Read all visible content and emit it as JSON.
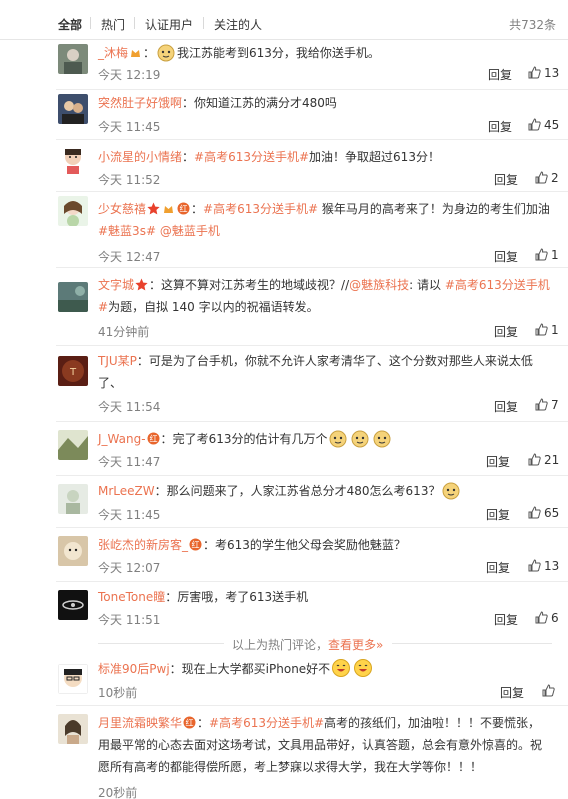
{
  "tabs": [
    {
      "label": "全部",
      "active": true
    },
    {
      "label": "热门",
      "active": false
    },
    {
      "label": "认证用户",
      "active": false
    },
    {
      "label": "关注的人",
      "active": false
    }
  ],
  "total_label": "共732条",
  "reply_label": "回复",
  "comments": [
    {
      "user": "_沐梅",
      "sep": "：",
      "text_a": "我江苏能考到613分，我给你送手机。",
      "time": "今天 12:19",
      "likes": "13"
    },
    {
      "user": "突然肚子好饿啊",
      "sep": "：",
      "text_a": "你知道江苏的满分才480吗",
      "time": "今天 11:45",
      "likes": "45"
    },
    {
      "user": "小流星的小情绪",
      "sep": "：",
      "topic": "#高考613分送手机#",
      "text_a": "加油！争取超过613分！",
      "time": "今天 11:52",
      "likes": "2"
    },
    {
      "user": "少女慈禧",
      "sep": "：",
      "topic": "#高考613分送手机#",
      "text_a": " 猴年马月的高考来了！为身边的考生们加油",
      "topic2": "#魅蓝3s#",
      "at": " @魅蓝手机",
      "time": "今天 12:47",
      "likes": "1"
    },
    {
      "user": "文字城",
      "sep": "：",
      "text_a": "这算不算对江苏考生的地域歧视？//",
      "at": "@魅族科技",
      "text_b": ": 请以 ",
      "topic": "#高考613分送手机#",
      "text_c": "为题，自拟 140 字以内的祝福语转发。",
      "time": "41分钟前",
      "likes": "1"
    },
    {
      "user": "TJU某P",
      "sep": "：",
      "text_a": "可是为了台手机，你就不允许人家考清华了、这个分数对那些人来说太低了、",
      "time": "今天 11:54",
      "likes": "7"
    },
    {
      "user": "J_Wang-",
      "sep": "：",
      "text_a": "完了考613分的估计有几万个",
      "time": "今天 11:47",
      "likes": "21"
    },
    {
      "user": "MrLeeZW",
      "sep": "：",
      "text_a": "那么问题来了，人家江苏省总分才480怎么考613？",
      "time": "今天 11:45",
      "likes": "65"
    },
    {
      "user": "张屹杰的新房客_",
      "sep": "：",
      "text_a": "考613的学生他父母会奖励他魅蓝？",
      "time": "今天 12:07",
      "likes": "13"
    },
    {
      "user": "ToneTone瞳",
      "sep": "：",
      "text_a": "厉害哦，考了613送手机",
      "time": "今天 11:51",
      "likes": "6"
    },
    {
      "user": "标准90后Pwj",
      "sep": "：",
      "text_a": "现在上大学都买iPhone好不",
      "time": "10秒前",
      "likes": ""
    },
    {
      "user": "月里流霜映繁华",
      "sep": "：",
      "topic": "#高考613分送手机#",
      "text_a": "高考的孩纸们，加油啦！！！不要慌张，用最平常的心态去面对这场考试，文具用品带好，认真答题，总会有意外惊喜的。祝愿所有高考的都能得偿所愿，考上梦寐以求得大学，我在大学等你！！！",
      "time": "20秒前",
      "likes": ""
    }
  ],
  "hot_footer": {
    "text": "以上为热门评论，",
    "more": "查看更多»"
  },
  "colors": {
    "accent": "#eb7350",
    "muted": "#808080",
    "text": "#333333"
  }
}
